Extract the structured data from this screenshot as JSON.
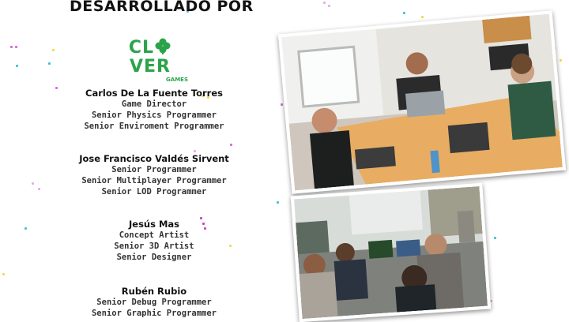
{
  "heading": "DESARROLLADO POR",
  "logo": {
    "word_prefix": "CL",
    "word_suffix": "VER",
    "sub": "GAMES",
    "color": "#2ca34a"
  },
  "team": [
    {
      "name": "Carlos De La Fuente Torres",
      "roles": [
        "Game Director",
        "Senior Physics Programmer",
        "Senior Enviroment Programmer"
      ]
    },
    {
      "name": "Jose Francisco Valdés Sirvent",
      "roles": [
        "Senior Programmer",
        "Senior Multiplayer Programmer",
        "Senior LOD Programmer"
      ]
    },
    {
      "name": "Jesús Mas",
      "roles": [
        "Concept Artist",
        "Senior 3D Artist",
        "Senior Designer"
      ]
    },
    {
      "name": "Rubén Rubio",
      "roles": [
        "Senior Debug Programmer",
        "Senior Graphic Programmer"
      ]
    }
  ],
  "photos": [
    "team-working-photo-1",
    "team-working-photo-2"
  ]
}
